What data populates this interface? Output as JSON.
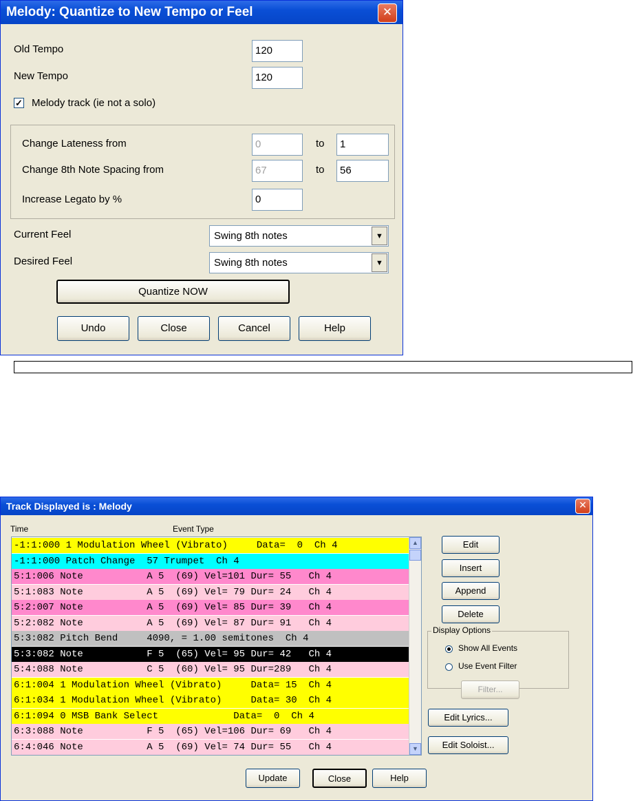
{
  "quantize_dialog": {
    "title": "Melody: Quantize to New Tempo or Feel",
    "old_tempo": {
      "label": "Old Tempo",
      "value": "120"
    },
    "new_tempo": {
      "label": "New Tempo",
      "value": "120"
    },
    "melody_checkbox": {
      "label": "Melody track (ie not a solo)",
      "checked": "✓"
    },
    "lateness": {
      "label": "Change Lateness from",
      "from": "0",
      "to_label": "to",
      "to": "1"
    },
    "spacing": {
      "label": "Change 8th Note Spacing from",
      "from": "67",
      "to_label": "to",
      "to": "56"
    },
    "legato": {
      "label": "Increase Legato by %",
      "value": "0"
    },
    "current_feel": {
      "label": "Current Feel",
      "value": "Swing 8th notes"
    },
    "desired_feel": {
      "label": "Desired Feel",
      "value": "Swing 8th notes"
    },
    "quantize_button": "Quantize NOW",
    "buttons": {
      "undo": "Undo",
      "close": "Close",
      "cancel": "Cancel",
      "help": "Help"
    }
  },
  "track_dialog": {
    "title": "Track Displayed is : Melody",
    "col_time": "Time",
    "col_event": "Event Type",
    "rows": [
      {
        "text": "-1:1:000 1 Modulation Wheel (Vibrato)     Data=  0  Ch 4",
        "bg": "#ffff00",
        "fg": "#000000"
      },
      {
        "text": "-1:1:000 Patch Change  57 Trumpet  Ch 4",
        "bg": "#00ffff",
        "fg": "#000000"
      },
      {
        "text": "5:1:006 Note           A 5  (69) Vel=101 Dur= 55   Ch 4",
        "bg": "#ff88cc",
        "fg": "#000000"
      },
      {
        "text": "5:1:083 Note           A 5  (69) Vel= 79 Dur= 24   Ch 4",
        "bg": "#ffccdd",
        "fg": "#000000"
      },
      {
        "text": "5:2:007 Note           A 5  (69) Vel= 85 Dur= 39   Ch 4",
        "bg": "#ff88cc",
        "fg": "#000000"
      },
      {
        "text": "5:2:082 Note           A 5  (69) Vel= 87 Dur= 91   Ch 4",
        "bg": "#ffccdd",
        "fg": "#000000"
      },
      {
        "text": "5:3:082 Pitch Bend     4090, = 1.00 semitones  Ch 4",
        "bg": "#c0c0c0",
        "fg": "#000000"
      },
      {
        "text": "5:3:082 Note           F 5  (65) Vel= 95 Dur= 42   Ch 4",
        "bg": "#000000",
        "fg": "#ffffff"
      },
      {
        "text": "5:4:088 Note           C 5  (60) Vel= 95 Dur=289   Ch 4",
        "bg": "#ffccdd",
        "fg": "#000000"
      },
      {
        "text": "6:1:004 1 Modulation Wheel (Vibrato)     Data= 15  Ch 4",
        "bg": "#ffff00",
        "fg": "#000000"
      },
      {
        "text": "6:1:034 1 Modulation Wheel (Vibrato)     Data= 30  Ch 4",
        "bg": "#ffff00",
        "fg": "#000000"
      },
      {
        "text": "6:1:094 0 MSB Bank Select             Data=  0  Ch 4",
        "bg": "#ffff00",
        "fg": "#000000"
      },
      {
        "text": "6:3:088 Note           F 5  (65) Vel=106 Dur= 69   Ch 4",
        "bg": "#ffccdd",
        "fg": "#000000"
      },
      {
        "text": "6:4:046 Note           A 5  (69) Vel= 74 Dur= 55   Ch 4",
        "bg": "#ffccdd",
        "fg": "#000000"
      }
    ],
    "buttons": {
      "edit": "Edit",
      "insert": "Insert",
      "append": "Append",
      "delete": "Delete",
      "filter": "Filter...",
      "edit_lyrics": "Edit Lyrics...",
      "edit_soloist": "Edit Soloist...",
      "update": "Update",
      "close": "Close",
      "help": "Help"
    },
    "display_options": {
      "label": "Display Options",
      "show_all": "Show All Events",
      "use_filter": "Use Event Filter"
    }
  }
}
